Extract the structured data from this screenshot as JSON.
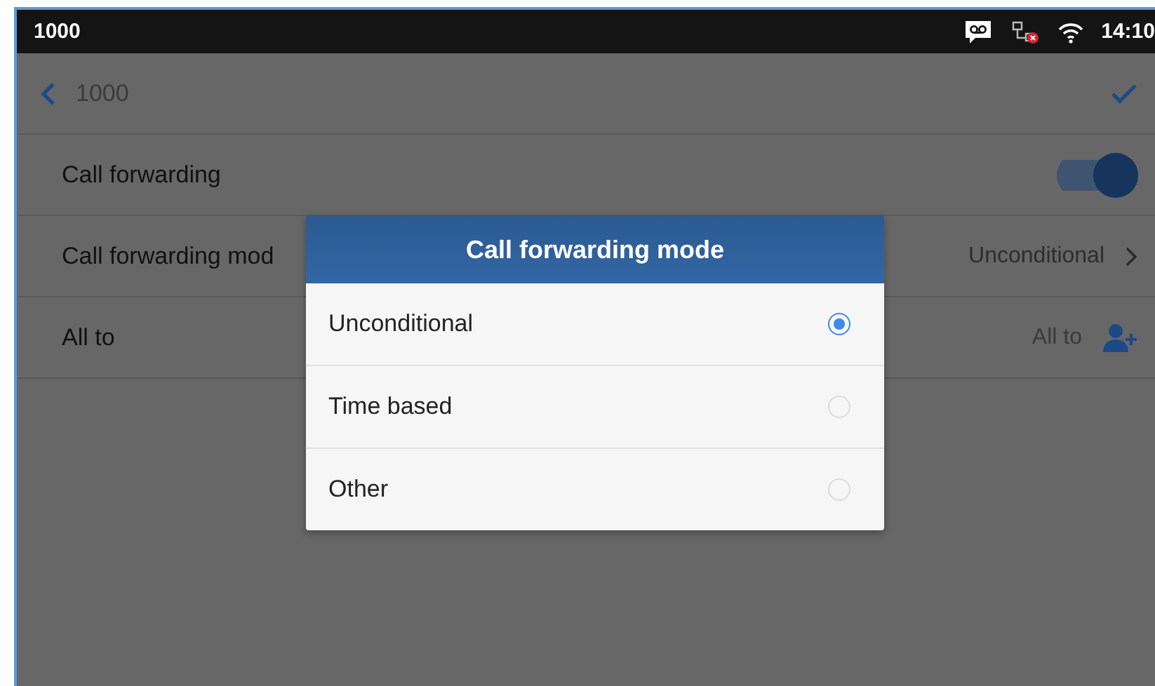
{
  "status_bar": {
    "title": "1000",
    "time": "14:10"
  },
  "header": {
    "title": "1000"
  },
  "settings": [
    {
      "kind": "toggle",
      "label": "Call forwarding",
      "on": true
    },
    {
      "kind": "select",
      "label": "Call forwarding mod",
      "value": "Unconditional"
    },
    {
      "kind": "contact",
      "label": "All to",
      "value": "All to"
    }
  ],
  "dialog": {
    "title": "Call forwarding mode",
    "options": [
      {
        "label": "Unconditional",
        "selected": true
      },
      {
        "label": "Time based",
        "selected": false
      },
      {
        "label": "Other",
        "selected": false
      }
    ]
  }
}
